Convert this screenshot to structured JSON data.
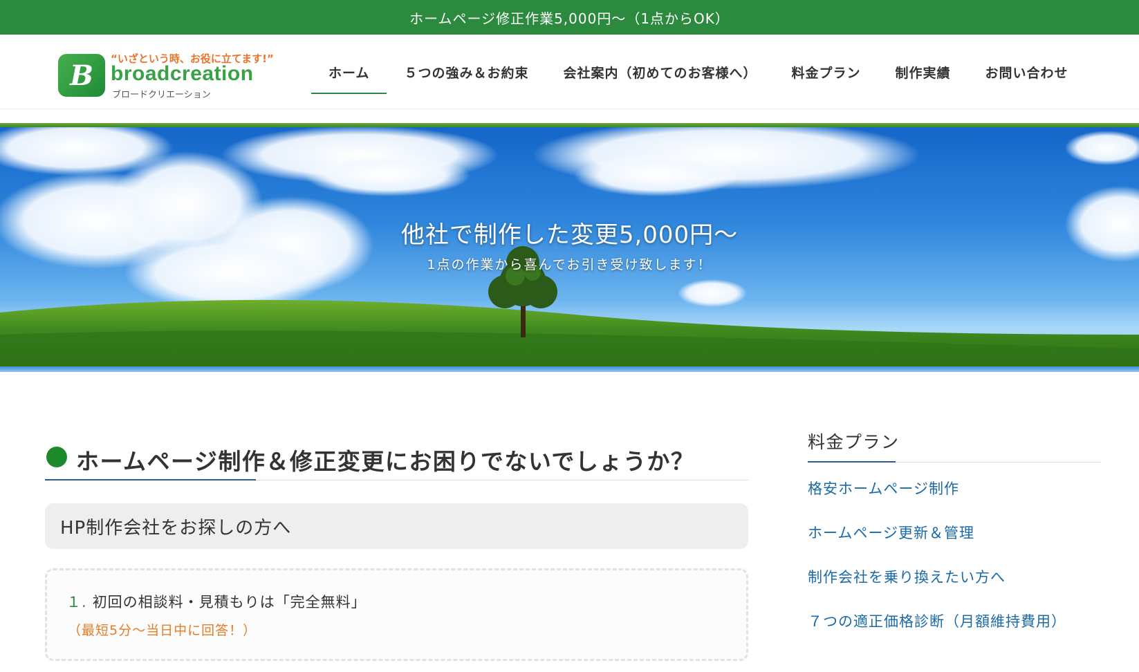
{
  "topbar": {
    "text": "ホームページ修正作業5,000円〜（1点からOK）"
  },
  "logo": {
    "mark": "B",
    "tagline": "“いざという時、お役に立てます!”",
    "name": "broadcreation",
    "kana": "ブロードクリエーション"
  },
  "nav": {
    "items": [
      {
        "label": "ホーム",
        "active": true
      },
      {
        "label": "５つの強み＆お約束"
      },
      {
        "label": "会社案内（初めてのお客様へ）"
      },
      {
        "label": "料金プラン"
      },
      {
        "label": "制作実績"
      },
      {
        "label": "お問い合わせ"
      }
    ]
  },
  "hero": {
    "title": "他社で制作した変更5,000円〜",
    "subtitle": "1点の作業から喜んでお引き受け致します！"
  },
  "main": {
    "heading": "ホームページ制作＆修正変更にお困りでないでしょうか？",
    "subheading": "HP制作会社をお探しの方へ",
    "feature": {
      "number": "１.",
      "text": "初回の相談料・見積もりは「完全無料」",
      "note": "（最短5分〜当日中に回答！）"
    }
  },
  "sidebar": {
    "title": "料金プラン",
    "links": [
      "格安ホームページ制作",
      "ホームページ更新＆管理",
      "制作会社を乗り換えたい方へ",
      "７つの適正価格診断（月額維持費用）"
    ]
  },
  "colors": {
    "brand_green": "#2b8a3e",
    "accent_orange": "#e57b25",
    "link_blue": "#1a6aa8"
  }
}
